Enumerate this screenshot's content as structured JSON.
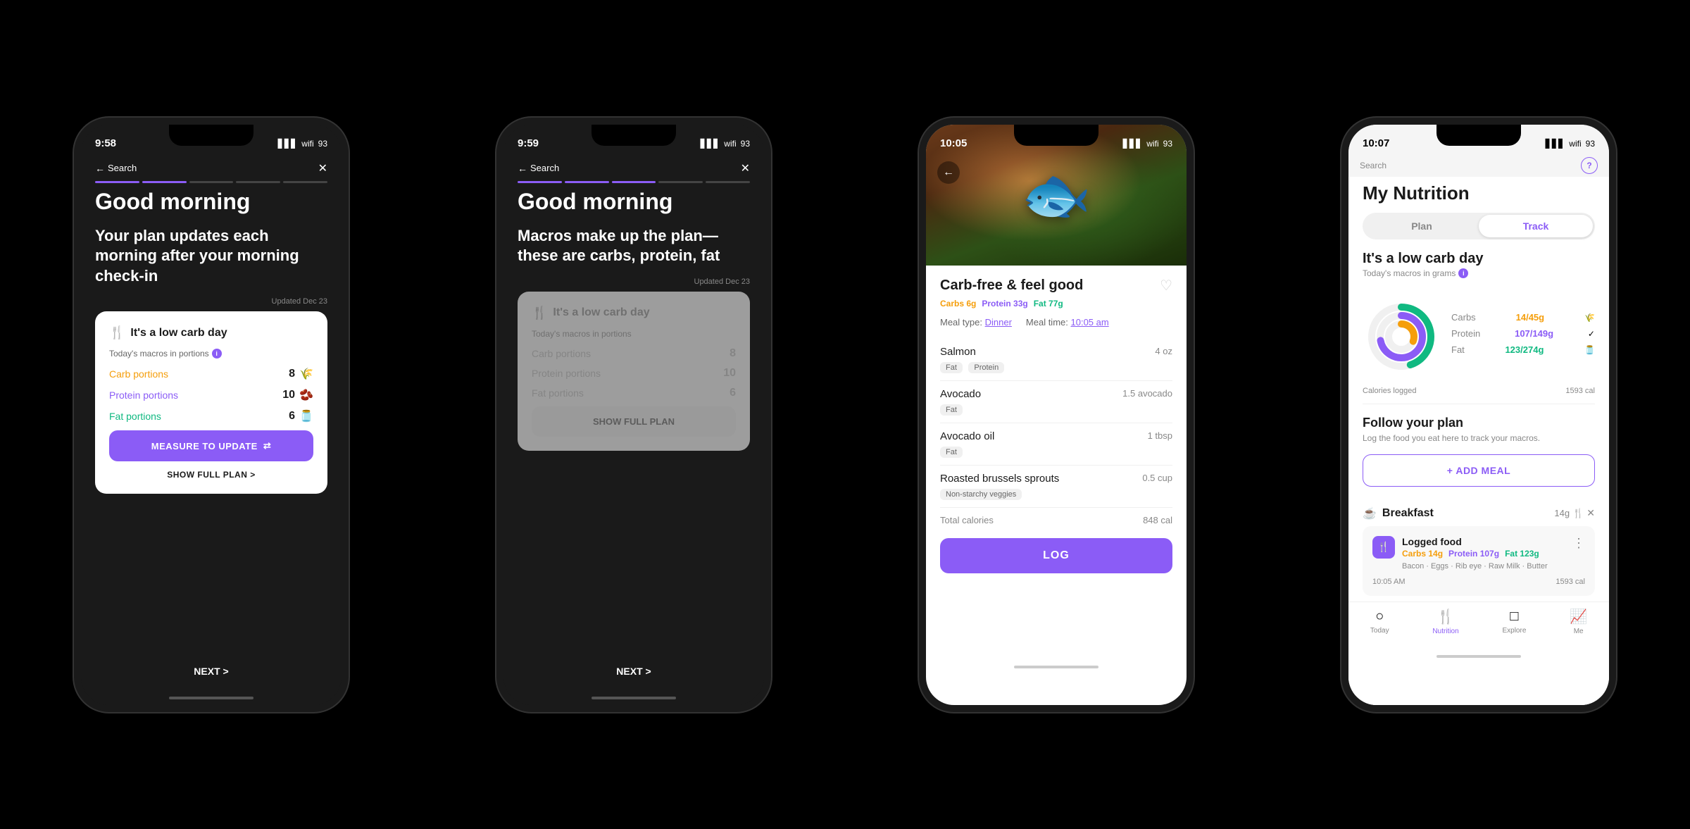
{
  "phones": [
    {
      "id": "phone1",
      "time": "9:58",
      "theme": "dark",
      "nav": {
        "back_icon": "←",
        "close_icon": "✕",
        "search_text": "Search"
      },
      "progress": [
        true,
        true,
        false,
        false,
        false
      ],
      "greeting": "Good morning",
      "subtitle": "Your plan updates each morning after your morning check-in",
      "updated_text": "Updated Dec 23",
      "card": {
        "icon": "🍴",
        "title": "It's a low carb day",
        "macros_label": "Today's macros in portions",
        "rows": [
          {
            "label": "Carb portions",
            "value": "8",
            "emoji": "🌾",
            "color": "carb"
          },
          {
            "label": "Protein portions",
            "value": "10",
            "emoji": "🫘",
            "color": "protein"
          },
          {
            "label": "Fat portions",
            "value": "6",
            "emoji": "🫙",
            "color": "fat"
          }
        ],
        "measure_btn": "MEASURE TO UPDATE",
        "show_plan": "SHOW FULL PLAN >"
      },
      "next_label": "NEXT >"
    },
    {
      "id": "phone2",
      "time": "9:59",
      "theme": "dark",
      "nav": {
        "back_icon": "←",
        "close_icon": "✕",
        "search_text": "Search"
      },
      "progress": [
        true,
        true,
        true,
        false,
        false
      ],
      "greeting": "Good morning",
      "subtitle": "Macros make up the plan—these are carbs, protein, fat",
      "updated_text": "Updated Dec 23",
      "card": {
        "icon": "🍴",
        "title": "It's a low carb day",
        "macros_label": "Today's macros in portions",
        "rows": [
          {
            "label": "Carb portions",
            "value": "8",
            "emoji": "🌾",
            "color": "muted"
          },
          {
            "label": "Protein portions",
            "value": "10",
            "emoji": "🫘",
            "color": "muted"
          },
          {
            "label": "Fat portions",
            "value": "6",
            "emoji": "🫙",
            "color": "muted"
          }
        ],
        "show_plan_btn": "SHOW FULL PLAN"
      },
      "next_label": "NEXT >"
    },
    {
      "id": "phone3",
      "time": "10:05",
      "theme": "mixed",
      "nav": {
        "back_icon": "←",
        "search_text": "Search"
      },
      "meal": {
        "title": "Carb-free & feel good",
        "carbs": "Carbs 6g",
        "protein": "Protein 33g",
        "fat": "Fat 77g",
        "meal_type_label": "Meal type:",
        "meal_type_value": "Dinner",
        "meal_time_label": "Meal time:",
        "meal_time_value": "10:05 am",
        "ingredients": [
          {
            "name": "Salmon",
            "tags": [
              "Fat",
              "Protein"
            ],
            "amount": "4 oz"
          },
          {
            "name": "Avocado",
            "tags": [
              "Fat"
            ],
            "amount": "1.5 avocado"
          },
          {
            "name": "Avocado oil",
            "tags": [
              "Fat"
            ],
            "amount": "1 tbsp"
          },
          {
            "name": "Roasted brussels sprouts",
            "tags": [
              "Non-starchy veggies"
            ],
            "amount": "0.5 cup"
          }
        ],
        "total_calories_label": "Total calories",
        "total_calories_value": "848 cal",
        "log_btn": "LOG"
      }
    },
    {
      "id": "phone4",
      "time": "10:07",
      "theme": "light",
      "nav": {
        "search_text": "Search",
        "question": "?"
      },
      "header": {
        "title": "My Nutrition",
        "plan_label": "Plan",
        "track_label": "Track",
        "active_tab": "Track"
      },
      "day_type": "It's a low carb day",
      "macros_subtitle": "Today's macros in grams",
      "donut": {
        "carbs": {
          "label": "Carbs",
          "value": "14/45g",
          "pct": 31,
          "color": "#F59E0B"
        },
        "protein": {
          "label": "Protein",
          "value": "107/149g",
          "pct": 72,
          "color": "#8B5CF6"
        },
        "fat": {
          "label": "Fat",
          "value": "123/274g",
          "pct": 45,
          "color": "#10B981"
        }
      },
      "calories_logged": {
        "label": "Calories logged",
        "value": "1593 cal"
      },
      "follow_plan": {
        "title": "Follow your plan",
        "subtitle": "Log the food you eat here to track your macros.",
        "add_meal_btn": "+ ADD MEAL"
      },
      "breakfast": {
        "icon": "☕",
        "name": "Breakfast",
        "cal_value": "14g",
        "logged_food": {
          "title": "Logged food",
          "carbs": "Carbs 14g",
          "protein": "Protein 107g",
          "fat": "Fat 123g",
          "desc": "Bacon · Eggs · Rib eye · Raw Milk · Butter",
          "time": "10:05 AM",
          "calories": "1593 cal"
        }
      },
      "bottom_nav": [
        {
          "icon": "○",
          "label": "Today",
          "active": false
        },
        {
          "icon": "🍴",
          "label": "Nutrition",
          "active": true
        },
        {
          "icon": "□",
          "label": "Explore",
          "active": false
        },
        {
          "icon": "📈",
          "label": "Me",
          "active": false
        }
      ]
    }
  ]
}
